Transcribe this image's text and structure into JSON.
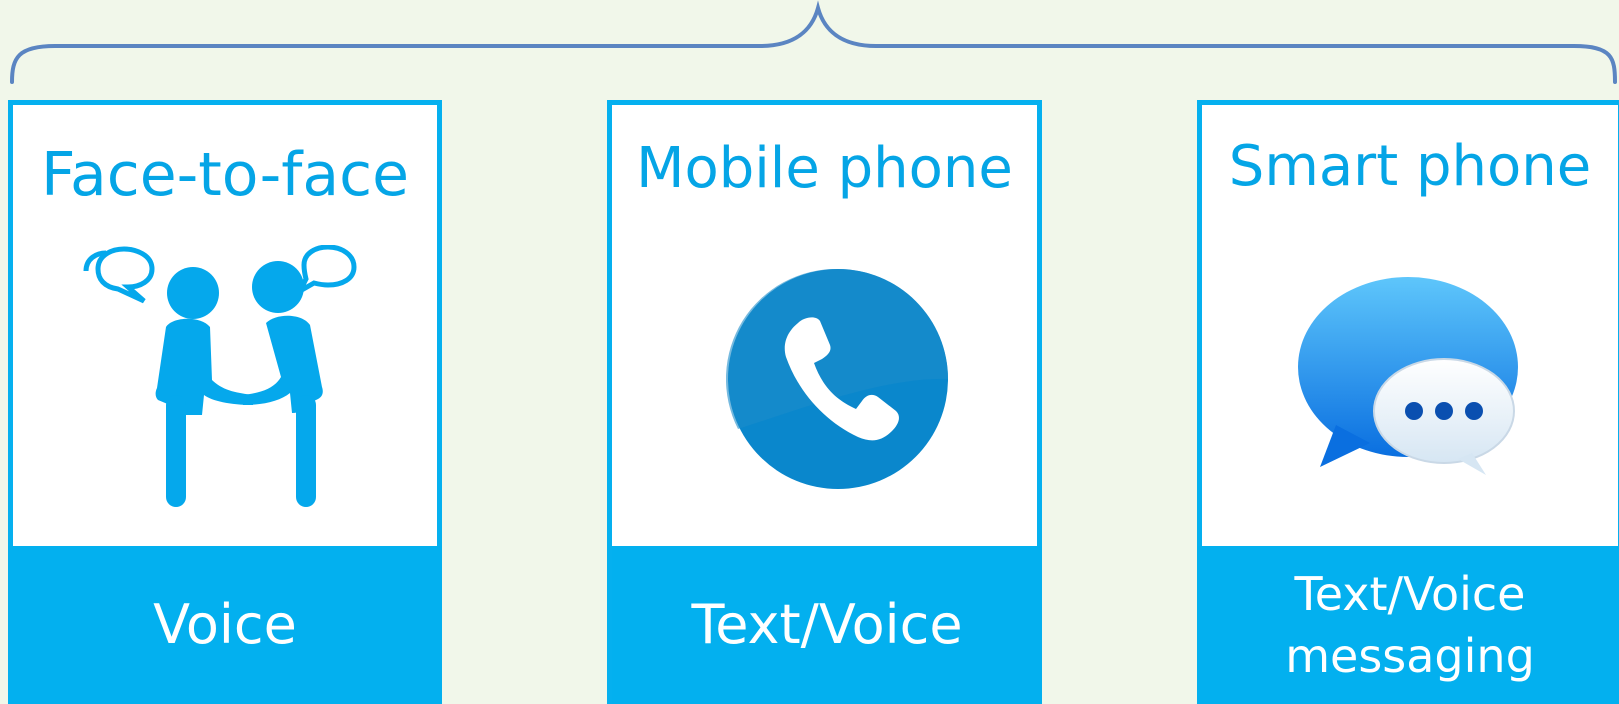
{
  "colors": {
    "background": "#f1f7ea",
    "accent": "#03b0ef",
    "title": "#05a5e6",
    "brace": "#5b85c2"
  },
  "cards": [
    {
      "title": "Face-to-face",
      "icon": "handshake-people-icon",
      "footer_lines": [
        "Voice"
      ]
    },
    {
      "title": "Mobile phone",
      "icon": "phone-call-icon",
      "footer_lines": [
        "Text/Voice"
      ]
    },
    {
      "title": "Smart phone",
      "icon": "message-bubbles-icon",
      "footer_lines": [
        "Text/Voice",
        "messaging"
      ]
    }
  ]
}
